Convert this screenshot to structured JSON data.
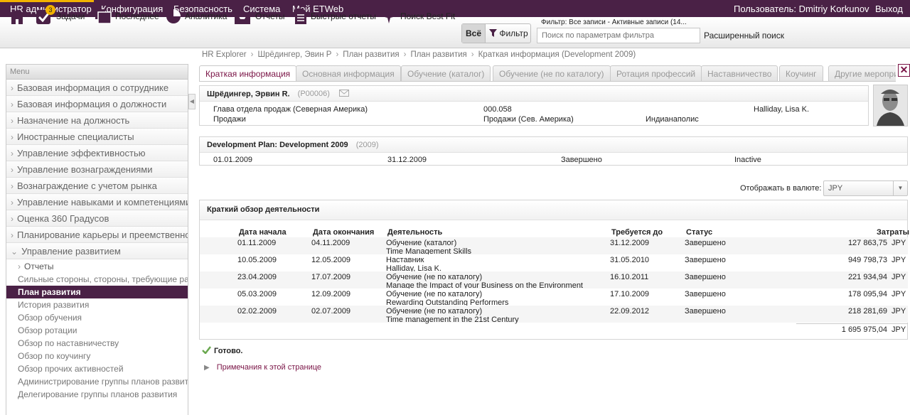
{
  "topnav": {
    "items": [
      "HR администратор",
      "Конфигурация",
      "Безопасность",
      "Система",
      "Мой ETWeb"
    ],
    "user": "Пользователь: Dmitriy Korkunov",
    "logout": "Выход"
  },
  "toolbar": {
    "tasks_badge": "3",
    "tasks": "Задачи",
    "recent": "Последнее",
    "analytics": "Аналитика",
    "reports": "Отчеты",
    "quick_reports": "Быстрые отчеты",
    "best_fit": "Поиск Best Fit",
    "all": "Всё",
    "filter": "Фильтр",
    "filter_label": "Фильтр: Все записи - Активные записи (14...",
    "filter_placeholder": "Поиск по параметрам фильтра",
    "advanced_search": "Расширенный поиск"
  },
  "breadcrumb": [
    "HR Explorer",
    "Шрёдингер, Эвин Р",
    "План развития",
    "План развития",
    "Краткая информация (Development 2009)"
  ],
  "sidebar": {
    "header": "Menu",
    "sections": [
      "Базовая информация о сотруднике",
      "Базовая информация о должности",
      "Назначение на должность",
      "Иностранные специалисты",
      "Управление эффективностью",
      "Управление вознаграждениями",
      "Вознаграждение с учетом рынка",
      "Управление навыками и компетенциями",
      "Оценка 360 Градусов",
      "Планирование карьеры и преемственности",
      "Управление развитием"
    ],
    "subsection": "Отчеты",
    "links": [
      "Сильные стороны, стороны, требующие развития",
      "План развития",
      "История развития",
      "Обзор обучения",
      "Обзор ротации",
      "Обзор по наставничеству",
      "Обзор по коучингу",
      "Обзор прочих активностей",
      "Администрирование группы планов развития",
      "Делегирование группы планов развития"
    ]
  },
  "tabs": [
    "Краткая информация",
    "Основная информация",
    "Обучение (каталог)",
    "Обучение (не по каталогу)",
    "Ротация профессий",
    "Наставничество",
    "Коучинг",
    "Другие мероприятия"
  ],
  "employee": {
    "name": "Шрёдингер, Эрвин R.",
    "id": "(P00006)",
    "position": "Глава отдела продаж (Северная Америка)",
    "position_code": "000.058",
    "manager": "Halliday, Lisa K.",
    "department": "Продажи",
    "org_unit": "Продажи (Сев. Америка)",
    "location": "Индианаполис"
  },
  "plan": {
    "title": "Development Plan: Development 2009",
    "year": "(2009)",
    "start": "01.01.2009",
    "end": "31.12.2009",
    "status": "Завершено",
    "state": "Inactive"
  },
  "currency": {
    "label": "Отображать в валюте:",
    "value": "JPY"
  },
  "activities": {
    "title": "Краткий обзор деятельности",
    "headers": {
      "start": "Дата начала",
      "end": "Дата окончания",
      "activity": "Деятельность",
      "due": "Требуется до",
      "status": "Статус",
      "cost": "Затраты"
    },
    "rows": [
      {
        "start": "01.11.2009",
        "end": "04.11.2009",
        "type": "Обучение (каталог)",
        "detail": "Time Management Skills",
        "due": "31.12.2009",
        "status": "Завершено",
        "cost": "127 863,75",
        "cur": "JPY"
      },
      {
        "start": "10.05.2009",
        "end": "12.05.2009",
        "type": "Наставник",
        "detail": "Halliday, Lisa K.",
        "due": "31.05.2010",
        "status": "Завершено",
        "cost": "949 798,73",
        "cur": "JPY"
      },
      {
        "start": "23.04.2009",
        "end": "17.07.2009",
        "type": "Обучение (не по каталогу)",
        "detail": "Manage the Impact of your Business on the Environment",
        "due": "16.10.2011",
        "status": "Завершено",
        "cost": "221 934,94",
        "cur": "JPY"
      },
      {
        "start": "05.03.2009",
        "end": "12.09.2009",
        "type": "Обучение (не по каталогу)",
        "detail": "Rewarding Outstanding Performers",
        "due": "17.10.2009",
        "status": "Завершено",
        "cost": "178 095,94",
        "cur": "JPY"
      },
      {
        "start": "02.02.2009",
        "end": "02.07.2009",
        "type": "Обучение (не по каталогу)",
        "detail": "Time management in the 21st Century",
        "due": "22.09.2012",
        "status": "Завершено",
        "cost": "218 281,69",
        "cur": "JPY"
      }
    ],
    "total": "1 695 975,04",
    "total_cur": "JPY"
  },
  "status_text": "Готово.",
  "notes_link": "Примечания к этой странице",
  "colors": {
    "brand": "#4a2146",
    "accent": "#f2b200",
    "link": "#7a1446"
  }
}
